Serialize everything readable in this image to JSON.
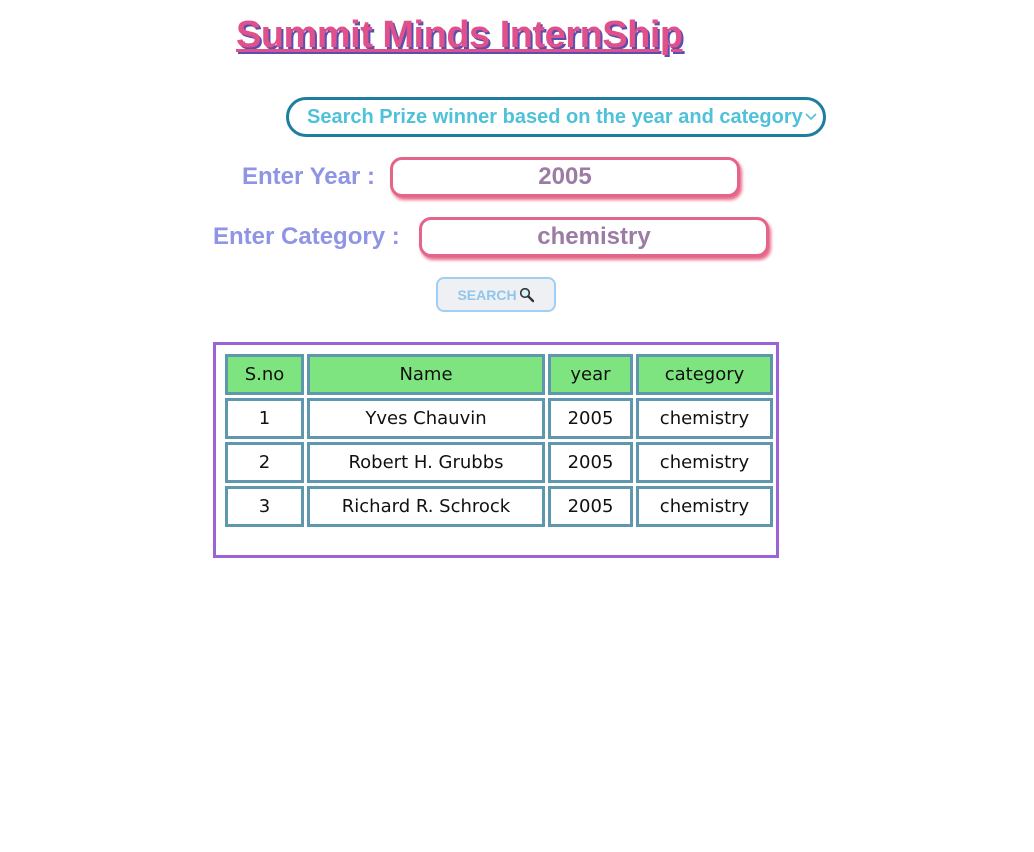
{
  "header": {
    "title": "Summit Minds InternShip"
  },
  "search_select": {
    "selected": "Search Prize winner based on the year and category",
    "icon": "chevron-down-icon"
  },
  "form": {
    "year_label": "Enter Year :",
    "year_value": "2005",
    "category_label": "Enter Category :",
    "category_value": "chemistry",
    "search_label": "SEARCH",
    "search_icon": "magnifier-icon"
  },
  "table": {
    "headers": [
      "S.no",
      "Name",
      "year",
      "category"
    ],
    "rows": [
      [
        "1",
        "Yves Chauvin",
        "2005",
        "chemistry"
      ],
      [
        "2",
        "Robert H. Grubbs",
        "2005",
        "chemistry"
      ],
      [
        "3",
        "Richard R. Schrock",
        "2005",
        "chemistry"
      ]
    ]
  },
  "colors": {
    "title": "#e0508a",
    "title_shadow": "#5a4fb0",
    "select_border": "#1f7da0",
    "select_text": "#4fc1d8",
    "label": "#8f95e4",
    "input_border": "#e4648a",
    "input_text": "#9c7ba4",
    "table_frame": "#9b63d4",
    "cell_border": "#5f98ac",
    "header_bg": "#7ee47f"
  }
}
